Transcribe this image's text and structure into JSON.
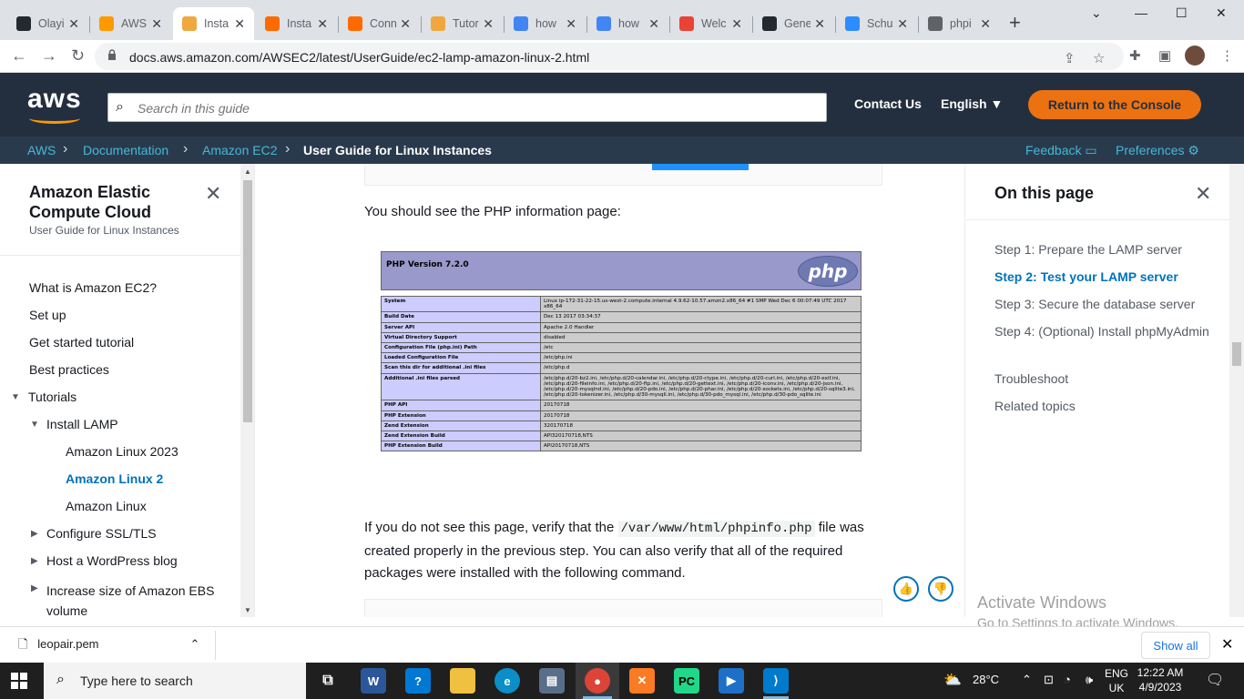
{
  "browser": {
    "tabs": [
      {
        "title": "Olayi",
        "icon": "github-icon",
        "color": "#24292f"
      },
      {
        "title": "AWS",
        "icon": "aws-icon",
        "color": "#ff9900"
      },
      {
        "title": "Insta",
        "icon": "aws-docs-icon",
        "color": "#f0a73d"
      },
      {
        "title": "Insta",
        "icon": "doc-icon",
        "color": "#ff6a00"
      },
      {
        "title": "Conn",
        "icon": "doc-icon",
        "color": "#ff6a00"
      },
      {
        "title": "Tutor",
        "icon": "aws-docs-icon",
        "color": "#f0a73d"
      },
      {
        "title": "how",
        "icon": "google-icon",
        "color": "#4285f4"
      },
      {
        "title": "how",
        "icon": "google-icon",
        "color": "#4285f4"
      },
      {
        "title": "Welc",
        "icon": "gmail-icon",
        "color": "#ea4335"
      },
      {
        "title": "Gene",
        "icon": "github-icon",
        "color": "#24292f"
      },
      {
        "title": "Schu",
        "icon": "zoom-icon",
        "color": "#2d8cff"
      },
      {
        "title": "phpi",
        "icon": "globe-icon",
        "color": "#5f6368"
      }
    ],
    "url": "docs.aws.amazon.com/AWSEC2/latest/UserGuide/ec2-lamp-amazon-linux-2.html"
  },
  "header": {
    "logo": "aws",
    "search_placeholder": "Search in this guide",
    "contact": "Contact Us",
    "language": "English ▼",
    "return_button": "Return to the Console"
  },
  "breadcrumb": {
    "items": [
      "AWS",
      "Documentation",
      "Amazon EC2",
      "User Guide for Linux Instances"
    ],
    "feedback": "Feedback",
    "preferences": "Preferences"
  },
  "left_nav": {
    "title": "Amazon Elastic Compute Cloud",
    "subtitle": "User Guide for Linux Instances",
    "items": [
      "What is Amazon EC2?",
      "Set up",
      "Get started tutorial",
      "Best practices",
      "Tutorials",
      "Install LAMP",
      "Amazon Linux 2023",
      "Amazon Linux 2",
      "Amazon Linux",
      "Configure SSL/TLS",
      "Host a WordPress blog",
      "Increase size of Amazon EBS volume"
    ]
  },
  "main": {
    "intro": "You should see the PHP information page:",
    "para_before": "If you do not see this page, verify that the ",
    "code": "/var/www/html/phpinfo.php",
    "para_after": " file was created properly in the previous step. You can also verify that all of the required packages were installed with the following command."
  },
  "phpinfo": {
    "version": "PHP Version 7.2.0",
    "logo": "php",
    "rows": [
      {
        "k": "System",
        "v": "Linux ip-172-31-22-15.us-west-2.compute.internal 4.9.62-10.57.amzn2.x86_64 #1 SMP Wed Dec 6 00:07:49 UTC 2017 x86_64"
      },
      {
        "k": "Build Date",
        "v": "Dec 13 2017 03:34:37"
      },
      {
        "k": "Server API",
        "v": "Apache 2.0 Handler"
      },
      {
        "k": "Virtual Directory Support",
        "v": "disabled"
      },
      {
        "k": "Configuration File (php.ini) Path",
        "v": "/etc"
      },
      {
        "k": "Loaded Configuration File",
        "v": "/etc/php.ini"
      },
      {
        "k": "Scan this dir for additional .ini files",
        "v": "/etc/php.d"
      },
      {
        "k": "Additional .ini files parsed",
        "v": "/etc/php.d/20-bz2.ini, /etc/php.d/20-calendar.ini, /etc/php.d/20-ctype.ini, /etc/php.d/20-curl.ini, /etc/php.d/20-exif.ini, /etc/php.d/20-fileinfo.ini, /etc/php.d/20-ftp.ini, /etc/php.d/20-gettext.ini, /etc/php.d/20-iconv.ini, /etc/php.d/20-json.ini, /etc/php.d/20-mysqlnd.ini, /etc/php.d/20-pdo.ini, /etc/php.d/20-phar.ini, /etc/php.d/20-sockets.ini, /etc/php.d/20-sqlite3.ini, /etc/php.d/20-tokenizer.ini, /etc/php.d/30-mysqli.ini, /etc/php.d/30-pdo_mysql.ini, /etc/php.d/30-pdo_sqlite.ini"
      },
      {
        "k": "PHP API",
        "v": "20170718"
      },
      {
        "k": "PHP Extension",
        "v": "20170718"
      },
      {
        "k": "Zend Extension",
        "v": "320170718"
      },
      {
        "k": "Zend Extension Build",
        "v": "API320170718,NTS"
      },
      {
        "k": "PHP Extension Build",
        "v": "API20170718,NTS"
      }
    ]
  },
  "toc": {
    "title": "On this page",
    "items": [
      "Step 1: Prepare the LAMP server",
      "Step 2: Test your LAMP server",
      "Step 3: Secure the database server",
      "Step 4: (Optional) Install phpMyAdmin",
      "Troubleshoot",
      "Related topics"
    ]
  },
  "watermark": {
    "line1": "Activate Windows",
    "line2": "Go to Settings to activate Windows."
  },
  "downloads": {
    "file": "leopair.pem",
    "show_all": "Show all"
  },
  "taskbar": {
    "search": "Type here to search",
    "weather": "28°C",
    "lang1": "ENG",
    "lang2": "UK",
    "time": "12:22 AM",
    "date": "4/9/2023"
  }
}
